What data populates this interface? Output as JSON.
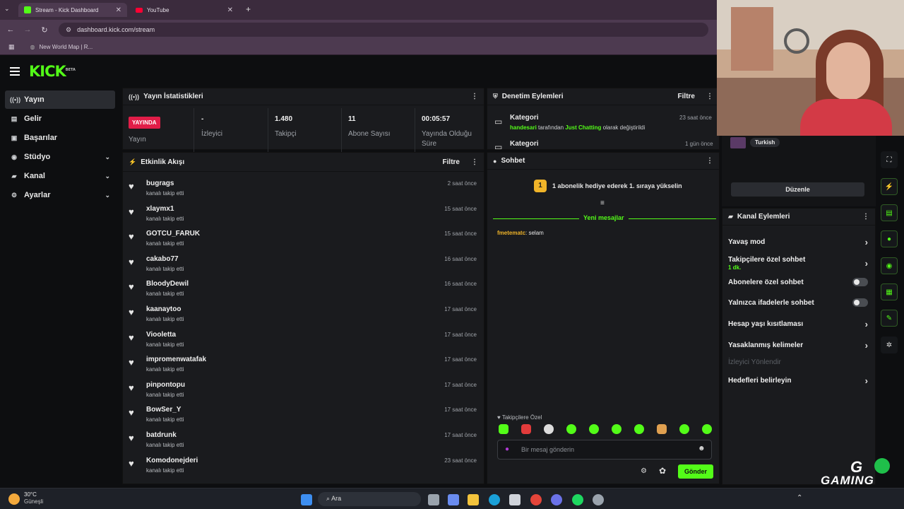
{
  "browser": {
    "tabs": [
      {
        "label": "Stream - Kick Dashboard"
      },
      {
        "label": "YouTube"
      }
    ],
    "url": "dashboard.kick.com/stream",
    "bookmark": "New World Map | R...",
    "new_tab": "+",
    "close": "✕"
  },
  "brand": {
    "logo": "KICK",
    "beta": "BETA",
    "accent": "#53fc18"
  },
  "sidebar": {
    "items": [
      {
        "label": "Yayın",
        "icon": "broadcast-icon"
      },
      {
        "label": "Gelir",
        "icon": "revenue-icon"
      },
      {
        "label": "Başarılar",
        "icon": "achievements-icon"
      },
      {
        "label": "Stüdyo",
        "icon": "studio-icon"
      },
      {
        "label": "Kanal",
        "icon": "channel-icon"
      },
      {
        "label": "Ayarlar",
        "icon": "gear-icon"
      }
    ]
  },
  "stats": {
    "title": "Yayın İstatistikleri",
    "live_badge": "YAYINDA",
    "live_label": "Yayın",
    "viewers_value": "-",
    "viewers_label": "İzleyici",
    "followers_value": "1.480",
    "followers_label": "Takipçi",
    "subs_value": "11",
    "subs_label": "Abone Sayısı",
    "uptime_value": "00:05:57",
    "uptime_label": "Yayında Olduğu Süre"
  },
  "moderation": {
    "title": "Denetim Eylemleri",
    "filter": "Filtre",
    "row1_title": "Kategori",
    "row1_user": "handesari",
    "row1_mid": "tarafından",
    "row1_cat": "Just Chatting",
    "row1_end": "olarak değiştirildi",
    "row1_time": "23 saat önce",
    "row2_title": "Kategori",
    "row2_time": "1 gün önce"
  },
  "activity": {
    "title": "Etkinlik Akışı",
    "filter": "Filtre",
    "items": [
      {
        "name": "bugrags",
        "action": "kanalı takip etti",
        "time": "2 saat önce"
      },
      {
        "name": "xlaymx1",
        "action": "kanalı takip etti",
        "time": "15 saat önce"
      },
      {
        "name": "GOTCU_FARUK",
        "action": "kanalı takip etti",
        "time": "15 saat önce"
      },
      {
        "name": "cakabo77",
        "action": "kanalı takip etti",
        "time": "16 saat önce"
      },
      {
        "name": "BloodyDewil",
        "action": "kanalı takip etti",
        "time": "16 saat önce"
      },
      {
        "name": "kaanaytoo",
        "action": "kanalı takip etti",
        "time": "17 saat önce"
      },
      {
        "name": "Viooletta",
        "action": "kanalı takip etti",
        "time": "17 saat önce"
      },
      {
        "name": "impromenwatafak",
        "action": "kanalı takip etti",
        "time": "17 saat önce"
      },
      {
        "name": "pinpontopu",
        "action": "kanalı takip etti",
        "time": "17 saat önce"
      },
      {
        "name": "BowSer_Y",
        "action": "kanalı takip etti",
        "time": "17 saat önce"
      },
      {
        "name": "batdrunk",
        "action": "kanalı takip etti",
        "time": "17 saat önce"
      },
      {
        "name": "Komodonejderi",
        "action": "kanalı takip etti",
        "time": "23 saat önce"
      }
    ]
  },
  "chat": {
    "title": "Sohbet",
    "gift_rank": "1",
    "gift_text": "1 abonelik hediye ederek 1. sıraya yükselin",
    "new_messages": "Yeni mesajlar",
    "msg_user": "fmetematc",
    "msg_text": ": selam",
    "followers_only": "Takipçilere Özel",
    "placeholder": "Bir mesaj gönderin",
    "send": "Gönder"
  },
  "right": {
    "language": "Turkish",
    "edit": "Düzenle",
    "actions_title": "Kanal Eylemleri",
    "slow": "Yavaş mod",
    "followers_chat": "Takipçilere özel sohbet",
    "followers_chat_sub": "1 dk.",
    "subs_chat": "Abonelere özel sohbet",
    "emote_chat": "Yalnızca ifadelerle sohbet",
    "age": "Hesap yaşı kısıtlaması",
    "banned": "Yasaklanmış kelimeler",
    "redirect": "İzleyici Yönlendir",
    "goals": "Hedefleri belirleyin"
  },
  "taskbar": {
    "temp": "30°C",
    "weather": "Güneşli",
    "search": "Ara"
  },
  "overlay": {
    "gaming": "GAMING"
  }
}
